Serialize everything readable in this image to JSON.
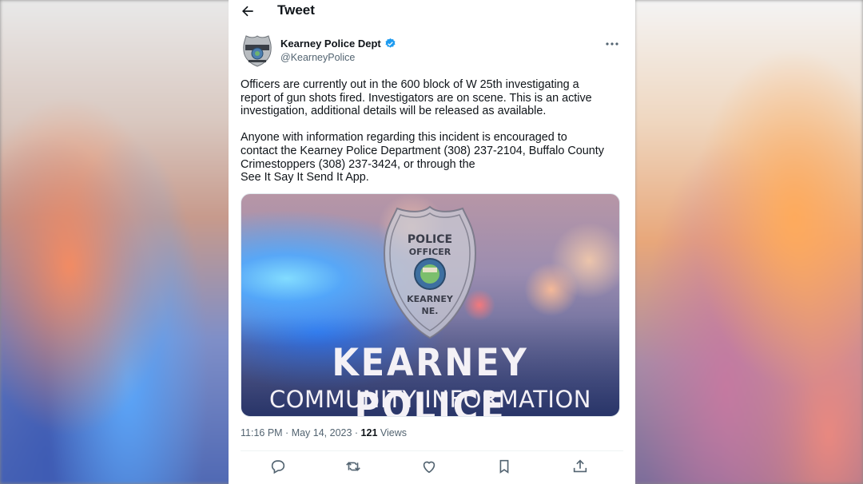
{
  "header": {
    "title": "Tweet"
  },
  "author": {
    "name": "Kearney Police Dept",
    "handle": "@KearneyPolice",
    "verified": true
  },
  "tweet": {
    "text": "Officers are currently out in the 600 block of W 25th investigating a\nreport of gun shots fired. Investigators are on scene. This is an active\ninvestigation, additional details will be released as available.\n\nAnyone with information regarding this incident is encouraged to\ncontact the Kearney Police Department (308) 237-2104, Buffalo County\nCrimestoppers (308) 237-3424, or through the\nSee It Say It Send It App."
  },
  "media": {
    "badge": {
      "top": "POLICE",
      "middle": "OFFICER",
      "city": "KEARNEY",
      "state": "NE."
    },
    "headline": "KEARNEY POLICE",
    "subheadline": "COMMUNITY INFORMATION"
  },
  "meta": {
    "time": "11:16 PM",
    "date": "May 14, 2023",
    "views_count": "121",
    "views_label": "Views"
  },
  "actions": [
    "reply-icon",
    "retweet-icon",
    "like-icon",
    "bookmark-icon",
    "share-icon"
  ],
  "colors": {
    "verified": "#1d9bf0",
    "text": "#0f1419",
    "secondary": "#536471"
  }
}
